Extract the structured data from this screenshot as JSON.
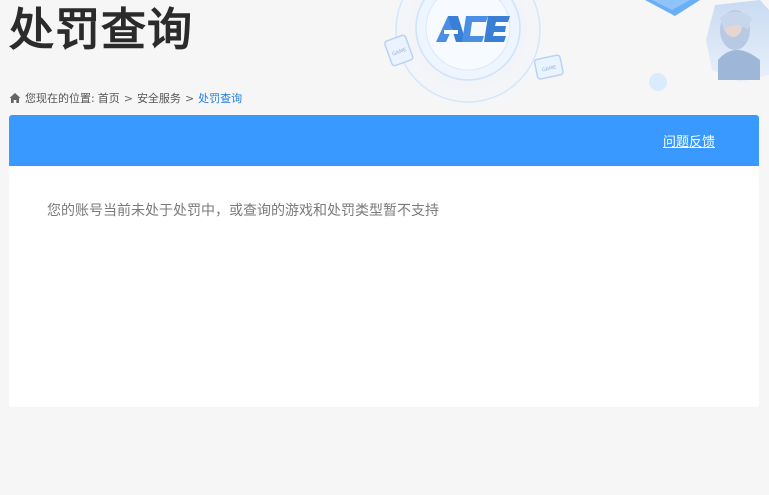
{
  "header": {
    "title": "处罚查询",
    "logo_text": "ACE",
    "deco_badge_1": "GAME",
    "deco_badge_2": "GAME"
  },
  "breadcrumb": {
    "prefix": "您现在的位置:",
    "items": [
      {
        "label": "首页"
      },
      {
        "label": "安全服务"
      },
      {
        "label": "处罚查询"
      }
    ],
    "separator": ">"
  },
  "panel": {
    "feedback_label": "问题反馈",
    "message": "您的账号当前未处于处罚中，或查询的游戏和处罚类型暂不支持"
  },
  "colors": {
    "accent": "#3a99ff",
    "link_current": "#1f7fe0",
    "title": "#2b2b2b",
    "message": "#7a7a7a",
    "background": "#f6f6f7"
  },
  "icons": {
    "breadcrumb": "home-icon"
  }
}
